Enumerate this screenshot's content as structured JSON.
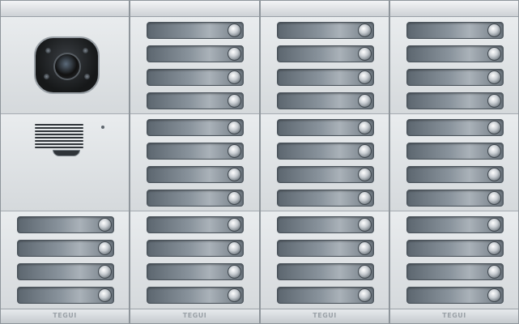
{
  "panel": {
    "brand_label": "TEGUI",
    "icons": {
      "camera": "camera-lens-icon",
      "speaker": "speaker-grille-icon",
      "call_button": "round-push-button-icon"
    },
    "colors": {
      "aluminium": "#d9dde0",
      "nameplate": "#7f8992",
      "button": "#c9ced3"
    },
    "layout": {
      "columns": 4,
      "keys_per_module": 4,
      "modules_per_column": 3,
      "first_column": [
        "camera",
        "audio",
        "keys"
      ]
    }
  }
}
